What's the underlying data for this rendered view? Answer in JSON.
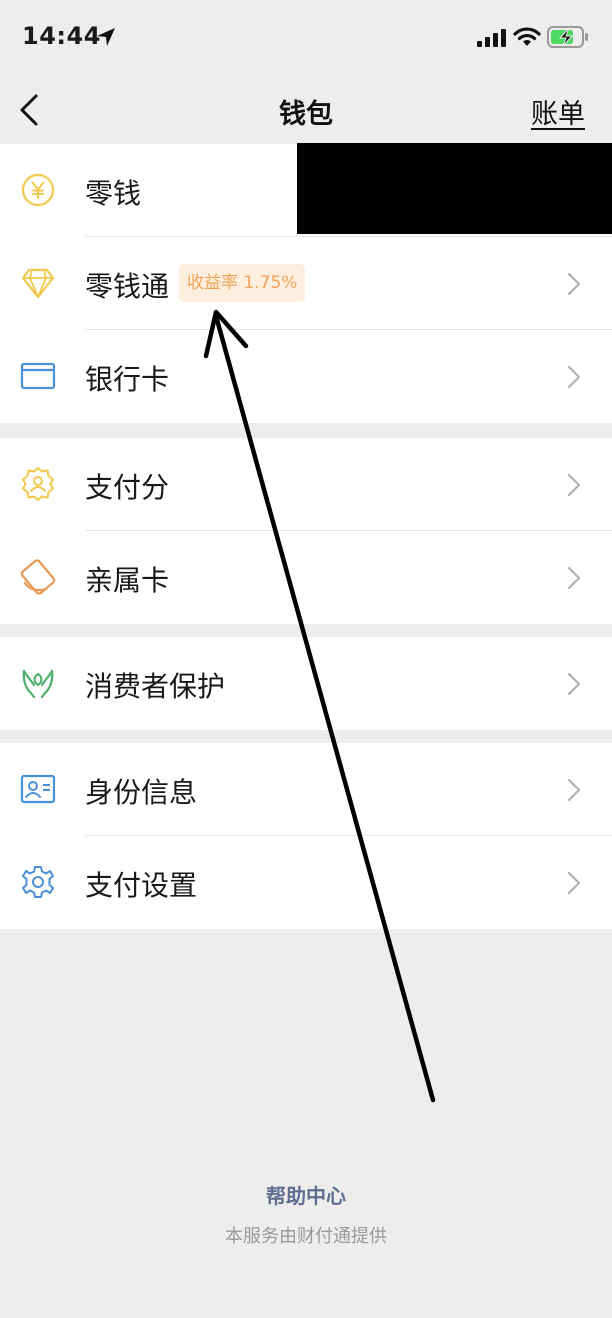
{
  "status_bar": {
    "time": "14:44"
  },
  "nav": {
    "title": "钱包",
    "right_action": "账单"
  },
  "sections": [
    {
      "items": [
        {
          "label": "零钱",
          "icon": "yuan-coin-icon"
        },
        {
          "label": "零钱通",
          "icon": "diamond-icon",
          "badge": "收益率 1.75%"
        },
        {
          "label": "银行卡",
          "icon": "bank-card-icon"
        }
      ]
    },
    {
      "items": [
        {
          "label": "支付分",
          "icon": "pay-score-icon"
        },
        {
          "label": "亲属卡",
          "icon": "family-card-icon"
        }
      ]
    },
    {
      "items": [
        {
          "label": "消费者保护",
          "icon": "consumer-protection-icon"
        }
      ]
    },
    {
      "items": [
        {
          "label": "身份信息",
          "icon": "id-card-icon"
        },
        {
          "label": "支付设置",
          "icon": "gear-icon"
        }
      ]
    }
  ],
  "footer": {
    "help_link": "帮助中心",
    "provider_note": "本服务由财付通提供"
  },
  "colors": {
    "background": "#ededed",
    "yellow_icon": "#f2c94c",
    "orange_icon": "#e89a55",
    "blue_icon": "#4a90d9",
    "green_icon": "#4caf6a",
    "badge_text": "#f0a35a",
    "badge_bg": "#fdeedd",
    "footer_link": "#5f6d8e"
  }
}
